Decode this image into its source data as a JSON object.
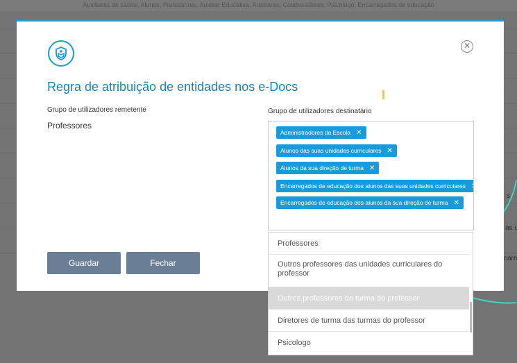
{
  "background": {
    "top_text": "Auxiliares de saúde, Alunos, Professores, Auxiliar Educativa, Auxiliares, Colaboradores, Psicologo, Encarregados de educação",
    "right_snippets": [
      "s",
      "as un",
      "carre"
    ]
  },
  "modal": {
    "title": "Regra de atribuição de entidades nos e-Docs",
    "logo_icon": "shield-book-icon",
    "close_icon": "close-circle-icon",
    "sender_label": "Grupo de utilizadores remetente",
    "sender_value": "Professores",
    "dest_label": "Grupo de utilizadores destinatário",
    "tags": [
      "Administradores da Escola",
      "Alunos das suas unidades curriculares",
      "Alunos da sua direção de turma",
      "Encarregados de educação dos alunos das suas unidades curriculares",
      "Encarregados de educação dos alunos da sua direção de turma"
    ],
    "tag_remove_glyph": "✕",
    "save_label": "Guardar",
    "close_label": "Fechar"
  },
  "dropdown": {
    "options": [
      "Professores",
      "Outros professores das unidades curriculares do professor",
      "Outros professores da turma do professor",
      "Diretores de turma das turmas do professor",
      "Psicologo"
    ],
    "highlighted_index": 2
  },
  "colors": {
    "accent": "#1a9bd9",
    "title": "#1a82c4",
    "button": "#6a7f96",
    "highlight": "#d9d9d9",
    "marker": "#f3d21a",
    "curve": "#3fd3c3"
  }
}
